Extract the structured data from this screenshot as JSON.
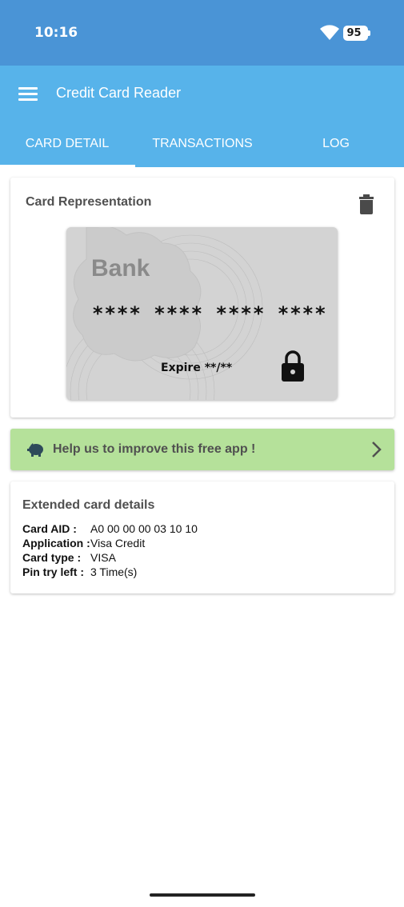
{
  "status_bar": {
    "time": "10:16",
    "battery": "95",
    "wifi_icon": "wifi-icon",
    "battery_icon": "battery-icon"
  },
  "app_bar": {
    "menu_icon": "hamburger-menu-icon",
    "title": "Credit Card Reader",
    "color": "#57b3ea"
  },
  "tabs": [
    {
      "label": "CARD DETAIL",
      "selected": true
    },
    {
      "label": "TRANSACTIONS",
      "selected": false
    },
    {
      "label": "LOG",
      "selected": false
    }
  ],
  "card_representation": {
    "title": "Card Representation",
    "delete_icon": "trash-icon",
    "bank_name": "Bank",
    "card_number": "**** **** **** ****",
    "expire": "Expire **/**",
    "lock_icon": "lock-icon"
  },
  "help_banner": {
    "text": "Help us to improve this free app !",
    "icon": "piggy-bank-icon",
    "chevron_icon": "chevron-right-icon",
    "color": "#b5e19a"
  },
  "extended_details": {
    "title": "Extended card details",
    "rows": [
      {
        "label": "Card AID :",
        "value": "A0 00 00 00 03 10 10"
      },
      {
        "label": "Application :",
        "value": "Visa Credit"
      },
      {
        "label": "Card type :",
        "value": "VISA"
      },
      {
        "label": "Pin try left :",
        "value": "3 Time(s)"
      }
    ]
  }
}
